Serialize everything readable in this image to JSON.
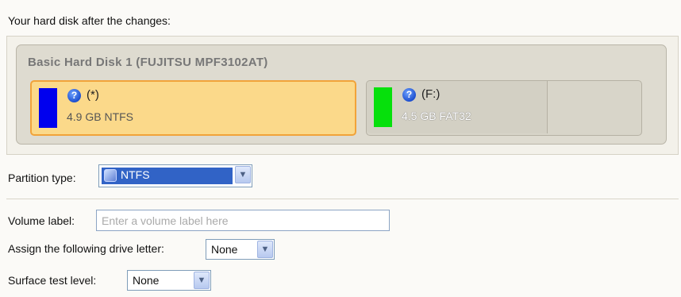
{
  "heading": "Your hard disk after the changes:",
  "disk": {
    "title": "Basic Hard Disk 1 (FUJITSU MPF3102AT)",
    "partitions": [
      {
        "name": "(*)",
        "size": "4.9 GB NTFS",
        "color": "#0000ee",
        "selected": true
      },
      {
        "name": "(F:)",
        "size": "4.5 GB FAT32",
        "color": "#06e00c",
        "selected": false
      }
    ]
  },
  "partition_type": {
    "label": "Partition type:",
    "value": "NTFS"
  },
  "volume_label": {
    "label": "Volume label:",
    "placeholder": "Enter a volume label here",
    "value": ""
  },
  "drive_letter": {
    "label": "Assign the following drive letter:",
    "value": "None"
  },
  "surface_test": {
    "label": "Surface test level:",
    "value": "None"
  },
  "icons": {
    "help": "help-icon",
    "fs": "ntfs-filesystem-icon",
    "dropdown": "chevron-down-icon"
  }
}
